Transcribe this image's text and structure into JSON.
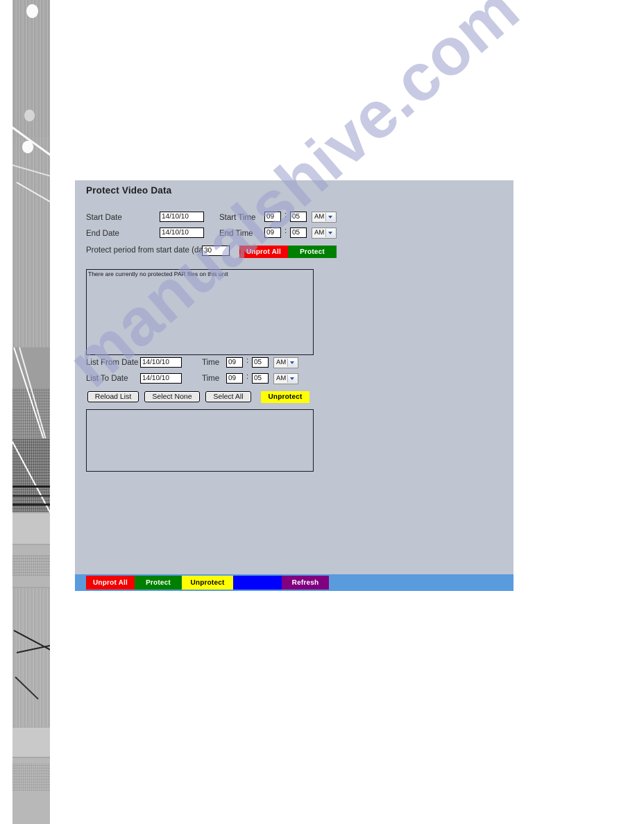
{
  "panel": {
    "title": "Protect Video Data"
  },
  "form": {
    "start_date_label": "Start Date",
    "start_date_value": "14/10/10",
    "end_date_label": "End Date",
    "end_date_value": "14/10/10",
    "start_time_label": "Start Time",
    "start_time_hour": "09",
    "start_time_minute": "05",
    "start_time_meridiem": "AM",
    "end_time_label": "End Time",
    "end_time_hour": "09",
    "end_time_minute": "05",
    "end_time_meridiem": "AM",
    "time_separator": ":",
    "protect_period_label": "Protect period from start date (days)",
    "protect_period_value": "30",
    "unprot_all_label": "Unprot All",
    "protect_label": "Protect"
  },
  "status_list": {
    "message": "There are currently no protected PAR files on this unit"
  },
  "list_filter": {
    "from_date_label": "List From Date",
    "from_date_value": "14/10/10",
    "from_time_label": "Time",
    "from_time_hour": "09",
    "from_time_minute": "05",
    "from_time_meridiem": "AM",
    "to_date_label": "List To Date",
    "to_date_value": "14/10/10",
    "to_time_label": "Time",
    "to_time_hour": "09",
    "to_time_minute": "05",
    "to_time_meridiem": "AM",
    "time_separator": ":",
    "reload_list_label": "Reload List",
    "select_none_label": "Select None",
    "select_all_label": "Select All",
    "unprotect_label": "Unprotect"
  },
  "results_list": {
    "items": []
  },
  "bottom_bar": {
    "buttons": [
      {
        "label": "Unprot All",
        "color": "#f50000",
        "text_color": "#ffffff"
      },
      {
        "label": "Protect",
        "color": "#008000",
        "text_color": "#ffffff"
      },
      {
        "label": "Unprotect",
        "color": "#ffff00",
        "text_color": "#000000"
      },
      {
        "label": "",
        "color": "#0000ff",
        "text_color": "#ffffff"
      },
      {
        "label": "Refresh",
        "color": "#800080",
        "text_color": "#ffffff"
      }
    ]
  },
  "watermark": {
    "text": "manualshive.com"
  },
  "colors": {
    "panel_background": "#bfc5d1",
    "bottom_bar_background": "#5a9bde",
    "unprot_all": "#f50000",
    "protect": "#008000",
    "unprotect": "#ffff00",
    "blank_blue": "#0000ff",
    "refresh": "#800080",
    "watermark": "#9aa0cc"
  }
}
